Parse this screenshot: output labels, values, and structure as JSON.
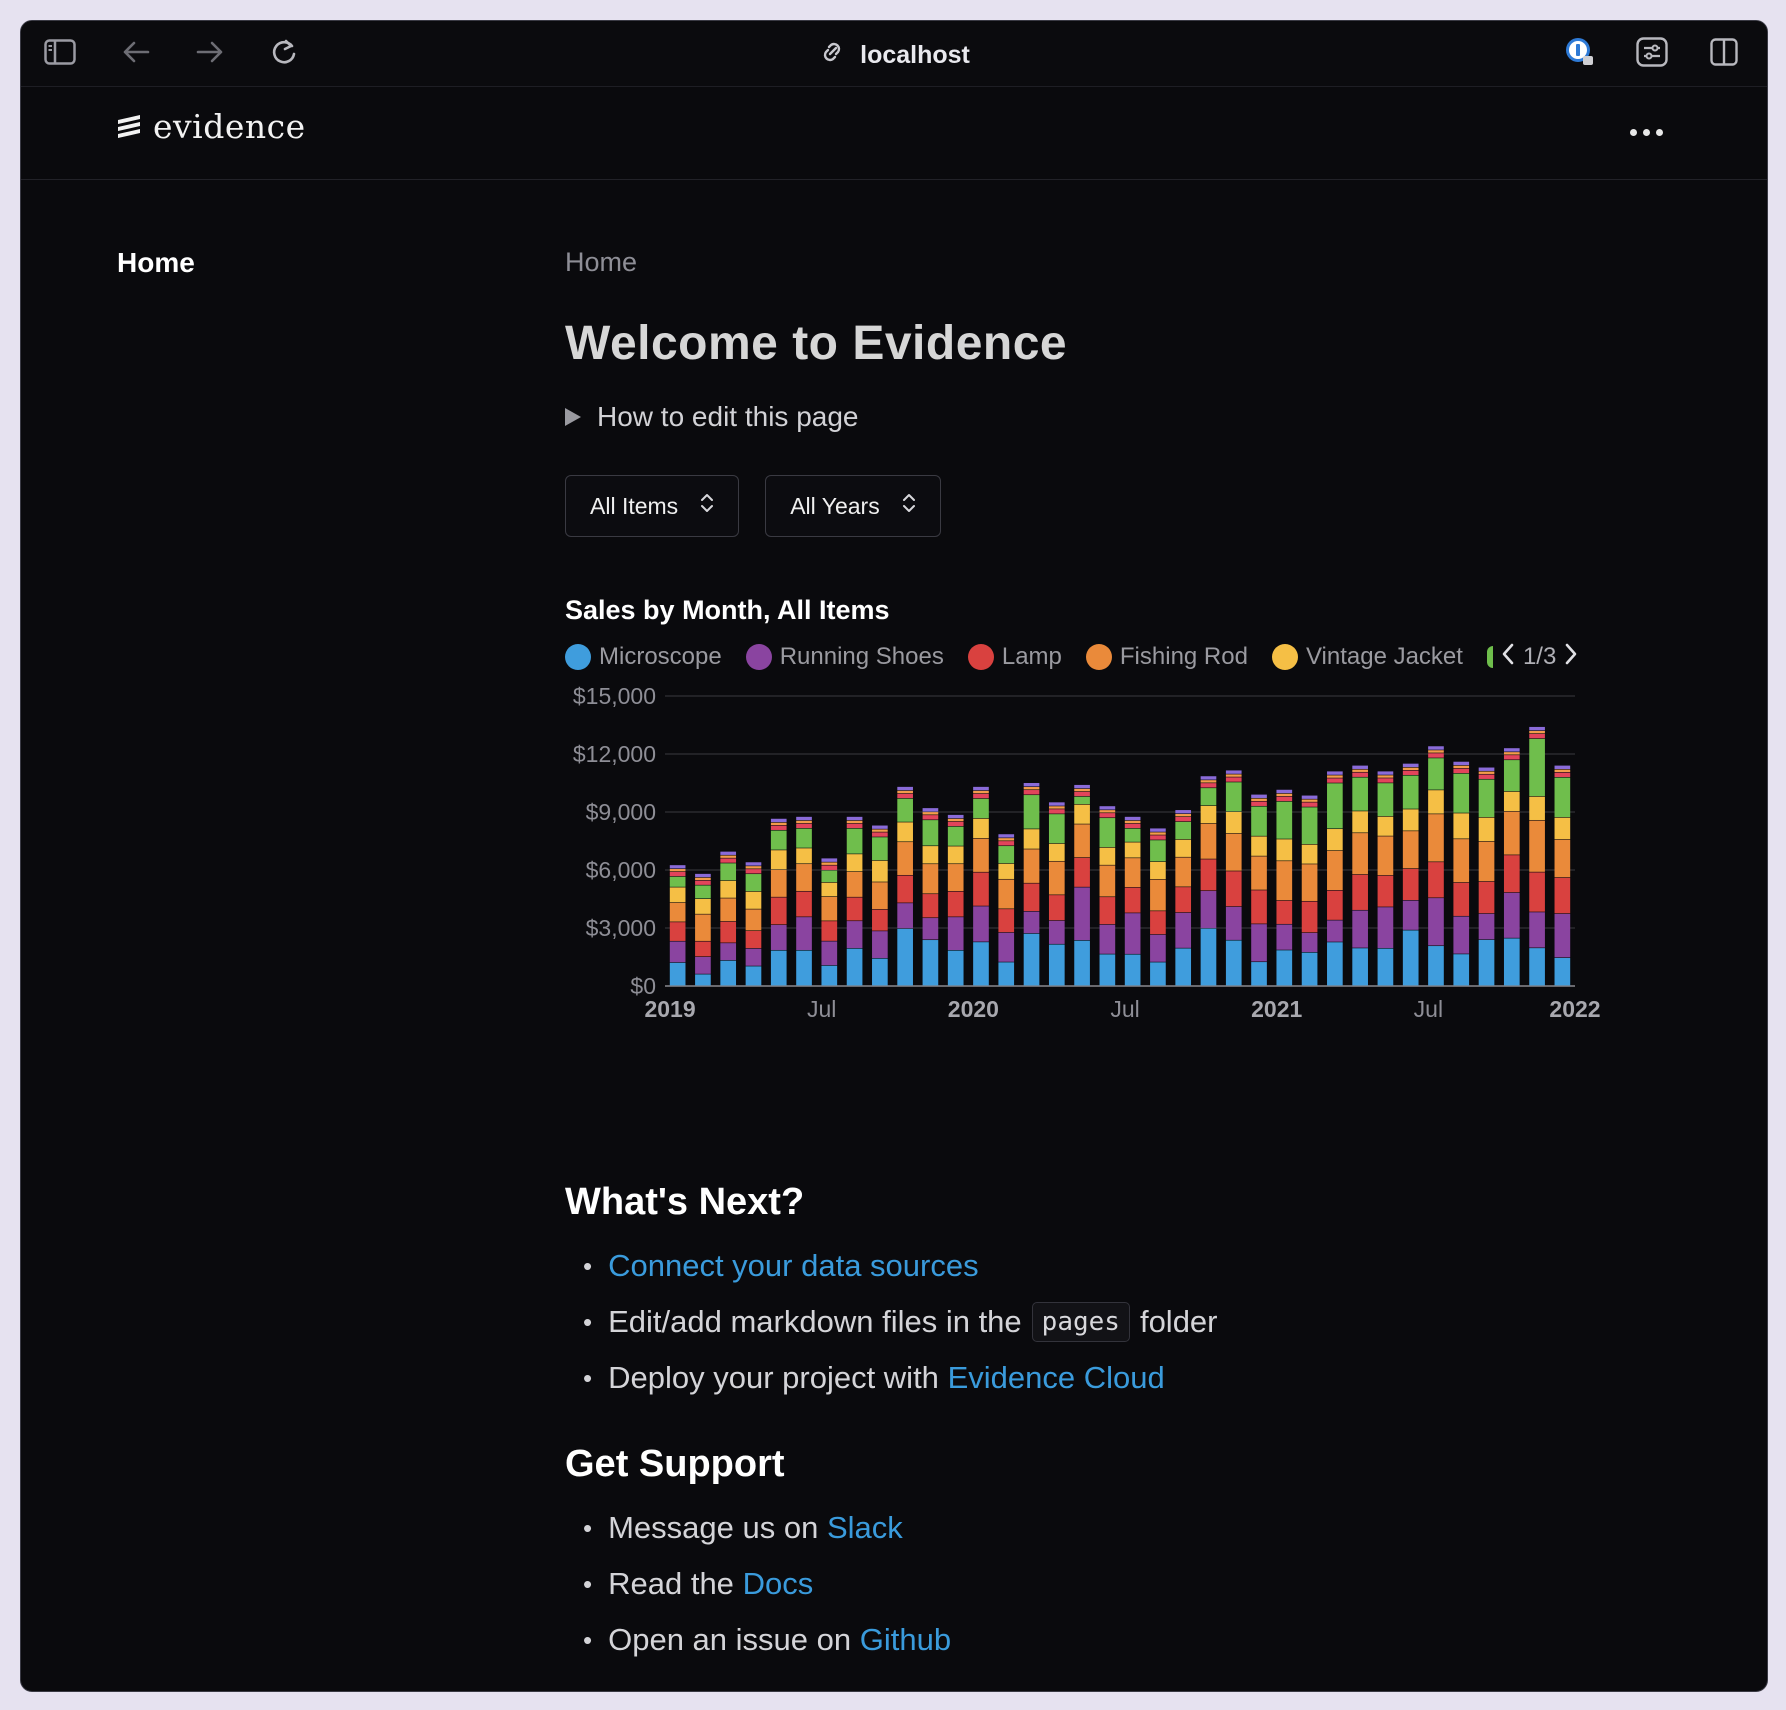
{
  "browser": {
    "url": "localhost"
  },
  "app": {
    "logo_text": "evidence",
    "nav": {
      "home": "Home"
    }
  },
  "page": {
    "breadcrumb": "Home",
    "title": "Welcome to Evidence",
    "details_summary": "How to edit this page",
    "filters": {
      "items": "All Items",
      "years": "All Years"
    },
    "chart_title": "Sales by Month, All Items",
    "legend": [
      {
        "label": "Microscope",
        "color": "#3f9ddd"
      },
      {
        "label": "Running Shoes",
        "color": "#8a44a0"
      },
      {
        "label": "Lamp",
        "color": "#d9413f"
      },
      {
        "label": "Fishing Rod",
        "color": "#ea8a3a"
      },
      {
        "label": "Vintage Jacket",
        "color": "#f5bf45"
      },
      {
        "label": "",
        "color": "#6fbe4c"
      }
    ],
    "legend_page": "1/3",
    "whats_next": {
      "heading": "What's Next?",
      "item1_link": "Connect your data sources",
      "item2_pre": "Edit/add markdown files in the",
      "item2_code": "pages",
      "item2_post": "folder",
      "item3_pre": "Deploy your project with",
      "item3_link": "Evidence Cloud"
    },
    "support": {
      "heading": "Get Support",
      "item1_pre": "Message us on",
      "item1_link": "Slack",
      "item2_pre": "Read the",
      "item2_link": "Docs",
      "item3_pre": "Open an issue on",
      "item3_link": "Github"
    }
  },
  "chart_data": {
    "type": "bar",
    "stacked": true,
    "title": "Sales by Month, All Items",
    "ylim": [
      0,
      15000
    ],
    "yticks": [
      "$0",
      "$3,000",
      "$6,000",
      "$9,000",
      "$12,000",
      "$15,000"
    ],
    "xtick_labels": [
      "2019",
      "Jul",
      "2020",
      "Jul",
      "2021",
      "Jul",
      "2022"
    ],
    "x": [
      "2019-01",
      "2019-02",
      "2019-03",
      "2019-04",
      "2019-05",
      "2019-06",
      "2019-07",
      "2019-08",
      "2019-09",
      "2019-10",
      "2019-11",
      "2019-12",
      "2020-01",
      "2020-02",
      "2020-03",
      "2020-04",
      "2020-05",
      "2020-06",
      "2020-07",
      "2020-08",
      "2020-09",
      "2020-10",
      "2020-11",
      "2020-12",
      "2021-01",
      "2021-02",
      "2021-03",
      "2021-04",
      "2021-05",
      "2021-06",
      "2021-07",
      "2021-08",
      "2021-09",
      "2021-10",
      "2021-11",
      "2021-12"
    ],
    "totals": [
      6250,
      5800,
      6950,
      6400,
      8650,
      8750,
      6600,
      8750,
      8300,
      10300,
      9200,
      8850,
      10300,
      7850,
      10500,
      9500,
      10400,
      9300,
      8750,
      8150,
      9100,
      10850,
      11150,
      9900,
      10150,
      9850,
      11100,
      11400,
      11100,
      11500,
      12400,
      11600,
      11300,
      12300,
      13400,
      11400
    ],
    "series": [
      {
        "name": "Microscope",
        "color": "#3f9ddd",
        "values": [
          1200,
          600,
          1300,
          1000,
          1800,
          1800,
          1000,
          1900,
          1400,
          2900,
          2300,
          1800,
          2200,
          1200,
          2600,
          2100,
          2300,
          1600,
          1600,
          1200,
          1900,
          2900,
          2300,
          1200,
          1800,
          1700,
          2200,
          1900,
          1900,
          2800,
          2000,
          1600,
          2300,
          2400,
          1900,
          1400
        ]
      },
      {
        "name": "Running Shoes",
        "color": "#8a44a0",
        "values": [
          1100,
          900,
          900,
          900,
          1300,
          1700,
          1200,
          1400,
          1400,
          1300,
          1100,
          1700,
          1800,
          1500,
          1100,
          1200,
          2700,
          1500,
          2100,
          1400,
          1800,
          1900,
          1700,
          1900,
          1300,
          1000,
          1100,
          1900,
          2100,
          1500,
          2400,
          1900,
          1300,
          2300,
          1800,
          2200
        ]
      },
      {
        "name": "Lamp",
        "color": "#d9413f",
        "values": [
          1000,
          800,
          1100,
          900,
          1400,
          1300,
          1000,
          1200,
          1100,
          1400,
          1200,
          1300,
          1700,
          1200,
          1400,
          1300,
          1500,
          1400,
          1300,
          1200,
          1300,
          1600,
          1800,
          1700,
          1200,
          1600,
          1500,
          1800,
          1600,
          1600,
          1800,
          1700,
          1600,
          1900,
          2000,
          1800
        ]
      },
      {
        "name": "Fishing Rod",
        "color": "#ea8a3a",
        "values": [
          1000,
          1400,
          1200,
          1100,
          1400,
          1400,
          1200,
          1300,
          1400,
          1700,
          1500,
          1400,
          1700,
          1500,
          1700,
          1700,
          1700,
          1600,
          1500,
          1600,
          1500,
          1800,
          1900,
          1700,
          2000,
          1900,
          2000,
          2100,
          2000,
          1900,
          2400,
          2200,
          2000,
          2200,
          2600,
          1900
        ]
      },
      {
        "name": "Vintage Jacket",
        "color": "#f5bf45",
        "values": [
          800,
          800,
          900,
          900,
          1000,
          800,
          700,
          900,
          1100,
          1000,
          900,
          900,
          1000,
          800,
          1000,
          900,
          1000,
          900,
          800,
          900,
          900,
          900,
          1100,
          1000,
          1100,
          1000,
          1100,
          1100,
          1000,
          1100,
          1200,
          1300,
          1200,
          1000,
          1200,
          1100
        ]
      },
      {
        "name": "",
        "color": "#6fbe4c",
        "values": [
          550,
          700,
          900,
          900,
          1000,
          1000,
          600,
          1300,
          1200,
          1200,
          1300,
          1000,
          1000,
          900,
          1700,
          1500,
          400,
          1500,
          700,
          1100,
          900,
          900,
          1500,
          1500,
          1900,
          1900,
          2300,
          1700,
          1700,
          1700,
          1600,
          2000,
          1900,
          1600,
          2900,
          2000
        ]
      },
      {
        "name": "",
        "color": "#e2445b",
        "values": [
          250,
          250,
          250,
          250,
          250,
          250,
          250,
          250,
          250,
          250,
          250,
          250,
          250,
          250,
          250,
          250,
          250,
          250,
          250,
          250,
          250,
          250,
          250,
          250,
          250,
          250,
          250,
          250,
          250,
          250,
          250,
          250,
          250,
          250,
          250,
          250
        ]
      },
      {
        "name": "",
        "color": "#f39c4a",
        "values": [
          150,
          150,
          150,
          150,
          150,
          150,
          150,
          150,
          150,
          150,
          150,
          150,
          150,
          150,
          150,
          150,
          150,
          150,
          150,
          150,
          150,
          150,
          150,
          150,
          150,
          150,
          150,
          150,
          150,
          150,
          150,
          150,
          150,
          150,
          150,
          150
        ]
      },
      {
        "name": "",
        "color": "#8a6bd8",
        "values": [
          200,
          200,
          200,
          200,
          200,
          200,
          200,
          200,
          200,
          200,
          200,
          200,
          200,
          200,
          200,
          200,
          200,
          200,
          200,
          200,
          200,
          200,
          200,
          200,
          200,
          200,
          200,
          200,
          200,
          200,
          200,
          200,
          200,
          200,
          200,
          200
        ]
      }
    ]
  }
}
